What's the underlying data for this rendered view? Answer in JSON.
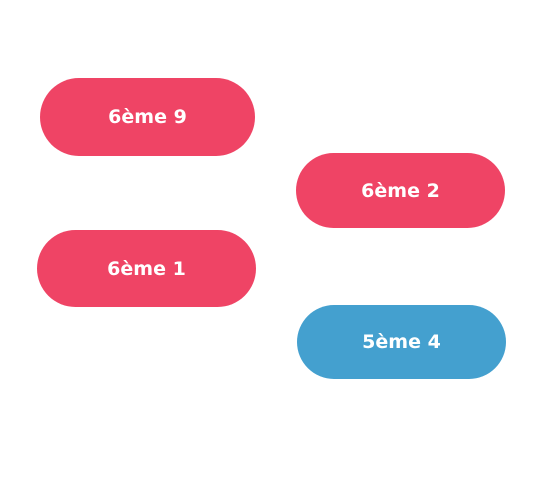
{
  "colors": {
    "red": "#EF4465",
    "blue": "#44A0CF",
    "text": "#FFFFFF"
  },
  "classes": [
    {
      "label": "6ème 9",
      "color": "red"
    },
    {
      "label": "6ème 2",
      "color": "red"
    },
    {
      "label": "6ème 1",
      "color": "red"
    },
    {
      "label": "5ème 4",
      "color": "blue"
    }
  ]
}
